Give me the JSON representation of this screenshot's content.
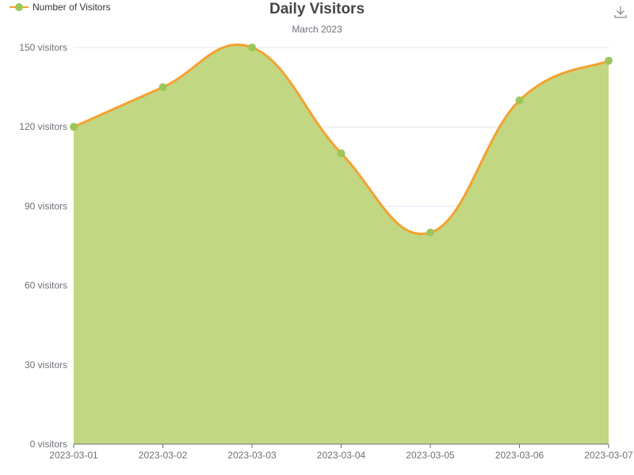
{
  "chart_data": {
    "type": "area",
    "title": "Daily Visitors",
    "subtitle": "March 2023",
    "legend": {
      "label": "Number of Visitors",
      "position": "top-left"
    },
    "categories": [
      "2023-03-01",
      "2023-03-02",
      "2023-03-03",
      "2023-03-04",
      "2023-03-05",
      "2023-03-06",
      "2023-03-07"
    ],
    "series": [
      {
        "name": "Number of Visitors",
        "values": [
          120,
          135,
          150,
          110,
          80,
          130,
          145
        ]
      }
    ],
    "y_ticks": [
      0,
      30,
      60,
      90,
      120,
      150
    ],
    "y_tick_suffix": " visitors",
    "ylim": [
      0,
      150
    ],
    "grid": true,
    "smooth": true,
    "colors": {
      "line": "#f4a130",
      "area": "#c1d782",
      "marker": "#9cc65a",
      "grid": "#e0e6f1",
      "axis": "#6e7079"
    }
  },
  "toolbar": {
    "download_icon": "download-icon"
  }
}
